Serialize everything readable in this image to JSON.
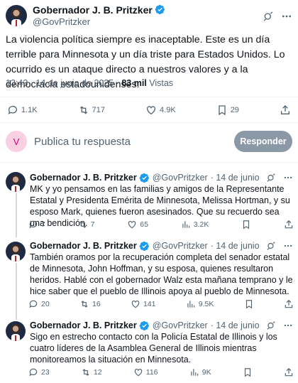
{
  "main_tweet": {
    "display_name": "Gobernador J. B. Pritzker",
    "handle": "@GovPritzker",
    "text": "La violencia política siempre es inaceptable. Este es un día terrible para Minnesota y un día triste para Estados Unidos. Lo ocurrido es un ataque directo a nuestros valores y a la democracia estadounidenses.",
    "time": "13:43 · 14 de junio de 2025 · ",
    "views_count": "83 mil",
    "views_label": " Vistas",
    "replies": "1.1K",
    "reposts": "717",
    "likes": "4.9K",
    "bookmarks": "29"
  },
  "reply_box": {
    "avatar_letter": "V",
    "placeholder": "Publica tu respuesta",
    "button_label": "Responder",
    "avatar_color": "#f9d0e2"
  },
  "thread": [
    {
      "display_name": "Gobernador J. B. Pritzker",
      "handle": "@GovPritzker",
      "date": "· 14 de junio",
      "text": "MK y yo pensamos en las familias y amigos de la Representante Estatal y Presidenta Emérita de Minnesota, Melissa Hortman, y su esposo Mark, quienes fueron asesinados. Que su recuerdo sea una bendición.",
      "replies": "7",
      "reposts": "7",
      "likes": "65",
      "views": "3.2K"
    },
    {
      "display_name": "Gobernador J. B. Pritzker",
      "handle": "@GovPritzker",
      "date": "· 14 de junio",
      "text": "También oramos por la recuperación completa del senador estatal de Minnesota, John Hoffman, y su esposa, quienes resultaron heridos. Hablé con el gobernador Walz esta mañana temprano y le hice saber que el pueblo de Illinois apoya al pueblo de Minnesota.",
      "replies": "20",
      "reposts": "16",
      "likes": "141",
      "views": "9.5K"
    },
    {
      "display_name": "Gobernador J. B. Pritzker",
      "handle": "@GovPritzker",
      "date": "· 14 de junio",
      "text": "Sigo en estrecho contacto con la Policía Estatal de Illinois y los cuatro líderes de la Asamblea General de Illinois mientras monitoreamos la situación en Minnesota.",
      "replies": "23",
      "reposts": "12",
      "likes": "116",
      "views": "9K"
    }
  ],
  "colors": {
    "verified": "#1d9bf0",
    "secondary_text": "#536471",
    "button_bg": "#8b98a5",
    "thread_line": "#cfd9de"
  }
}
